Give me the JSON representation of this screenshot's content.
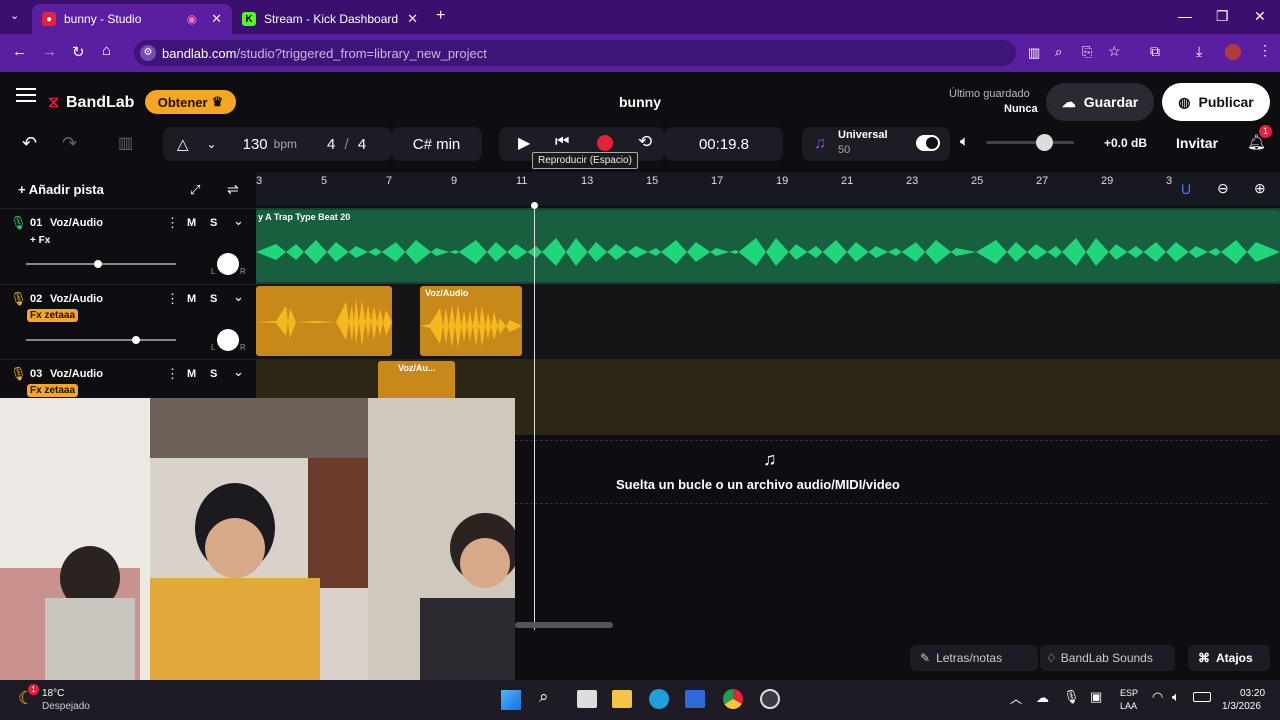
{
  "browser": {
    "tabs": [
      {
        "title": "bunny - Studio",
        "active": true
      },
      {
        "title": "Stream - Kick Dashboard",
        "active": false
      }
    ],
    "url_host": "bandlab.com",
    "url_path": "/studio?triggered_from=library_new_project"
  },
  "app": {
    "brand": "BandLab",
    "get_button": "Obtener",
    "project_title": "bunny",
    "last_saved_label": "Último guardado",
    "last_saved_value": "Nunca",
    "save_button": "Guardar",
    "publish_button": "Publicar"
  },
  "toolbar": {
    "bpm_value": "130",
    "bpm_unit": "bpm",
    "time_sig_num": "4",
    "time_sig_sep": "/",
    "time_sig_den": "4",
    "key": "C# min",
    "time_display": "00:19.8",
    "tooltip": "Reproducir (Espacio)",
    "universal_label": "Universal",
    "universal_value": "50",
    "volume_db": "+0.0 dB",
    "invite_button": "Invitar",
    "notification_count": "1"
  },
  "tracks_panel": {
    "add_track": "Añadir pista",
    "mute_label": "M",
    "solo_label": "S",
    "tracks": [
      {
        "number": "01",
        "name": "Voz/Audio",
        "fx": "+ Fx"
      },
      {
        "number": "02",
        "name": "Voz/Audio",
        "fx": "Fx zetaaa"
      },
      {
        "number": "03",
        "name": "Voz/Audio",
        "fx": "Fx zetaaa"
      }
    ],
    "pan_left": "L",
    "pan_right": "R"
  },
  "ruler": {
    "ticks": [
      "3",
      "5",
      "7",
      "9",
      "11",
      "13",
      "15",
      "17",
      "19",
      "21",
      "23",
      "25",
      "27",
      "29",
      "3"
    ]
  },
  "clips": {
    "track1_label": "y A  Trap Type Beat  20",
    "track2_clip2_label": "Voz/Audio",
    "track3_clip_label": "Voz/Au..."
  },
  "drop_zone": {
    "text": "Suelta un bucle o un archivo audio/MIDI/video"
  },
  "bottom_bar": {
    "lyrics": "Letras/notas",
    "sounds": "BandLab Sounds",
    "shortcuts": "Atajos"
  },
  "taskbar": {
    "weather_temp": "18°C",
    "weather_desc": "Despejado",
    "weather_badge": "1",
    "lang_top": "ESP",
    "lang_bottom": "LAA",
    "time": "03:20",
    "date": "1/3/2026"
  },
  "colors": {
    "accent_orange": "#f5a623",
    "track1_green": "#1fd67a",
    "track2_yellow": "#f5b81e",
    "record_red": "#e8213a",
    "browser_purple": "#5a1fa0"
  }
}
